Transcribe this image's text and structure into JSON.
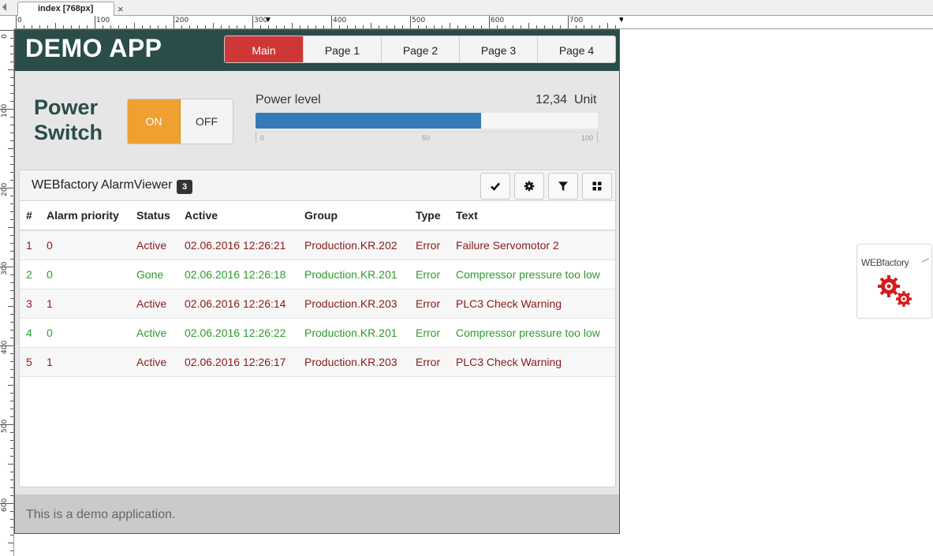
{
  "editor": {
    "tab_label": "index [768px]",
    "tab_close": "×",
    "ruler_h_labels": [
      "0",
      "100",
      "200",
      "300",
      "400",
      "500",
      "600",
      "700"
    ],
    "ruler_v_labels": [
      "0",
      "100",
      "200",
      "300",
      "400",
      "500",
      "600"
    ]
  },
  "app": {
    "brand": "DEMO APP",
    "nav": [
      {
        "label": "Main",
        "active": true
      },
      {
        "label": "Page 1",
        "active": false
      },
      {
        "label": "Page 2",
        "active": false
      },
      {
        "label": "Page 3",
        "active": false
      },
      {
        "label": "Page 4",
        "active": false
      }
    ],
    "power": {
      "title_line1": "Power",
      "title_line2": "Switch",
      "on_label": "ON",
      "off_label": "OFF",
      "state": "ON"
    },
    "power_level": {
      "label": "Power level",
      "value": "12,34",
      "unit": "Unit",
      "fill_percent": 66,
      "scale": [
        "0",
        "50",
        "100"
      ]
    },
    "alarm_viewer": {
      "title": "WEBfactory AlarmViewer",
      "badge": "3",
      "toolbar": [
        "check-icon",
        "gear-icon",
        "filter-icon",
        "grid-icon"
      ],
      "columns": [
        "#",
        "Alarm priority",
        "Status",
        "Active",
        "Group",
        "Type",
        "Text"
      ],
      "rows": [
        {
          "num": "1",
          "priority": "0",
          "status": "Active",
          "active": "02.06.2016 12:26:21",
          "group": "Production.KR.202",
          "type": "Error",
          "text": "Failure Servomotor 2",
          "color": "#8b1a1a"
        },
        {
          "num": "2",
          "priority": "0",
          "status": "Gone",
          "active": "02.06.2016 12:26:18",
          "group": "Production.KR.201",
          "type": "Error",
          "text": "Compressor pressure too low",
          "color": "#2e9a2e"
        },
        {
          "num": "3",
          "priority": "1",
          "status": "Active",
          "active": "02.06.2016 12:26:14",
          "group": "Production.KR.203",
          "type": "Error",
          "text": "PLC3 Check Warning",
          "color": "#8b1a1a"
        },
        {
          "num": "4",
          "priority": "0",
          "status": "Active",
          "active": "02.06.2016 12:26:22",
          "group": "Production.KR.201",
          "type": "Error",
          "text": "Compressor pressure too low",
          "color": "#2e9a2e"
        },
        {
          "num": "5",
          "priority": "1",
          "status": "Active",
          "active": "02.06.2016 12:26:17",
          "group": "Production.KR.203",
          "type": "Error",
          "text": "PLC3 Check Warning",
          "color": "#8b1a1a"
        }
      ]
    },
    "footer": "This is a demo application."
  },
  "logo_widget": {
    "text": "WEBfactory"
  },
  "colors": {
    "topbar": "#2b4d4a",
    "nav_active": "#cf3737",
    "toggle_on": "#f0a030",
    "progress": "#3579b8"
  }
}
